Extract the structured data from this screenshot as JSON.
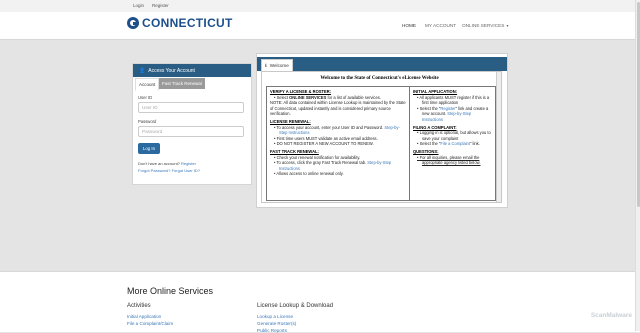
{
  "topbar": {
    "login": "Login",
    "register": "Register"
  },
  "header": {
    "logo_text": "CONNECTICUT",
    "nav": {
      "home": "HOME",
      "my_account": "MY ACCOUNT",
      "online_services": "ONLINE SERVICES"
    }
  },
  "login": {
    "heading": "Access Your Account",
    "tabs": {
      "account": "Account",
      "fast_track": "Fast Track Renewal"
    },
    "user_id_label": "User ID",
    "user_id_placeholder": "User ID",
    "password_label": "Password",
    "password_placeholder": "Password",
    "login_button": "Log In",
    "no_account_text": "Don't have an account?",
    "register_link": "Register",
    "forgot_password": "Forgot Password?",
    "forgot_user_id": "Forgot User ID?"
  },
  "welcome": {
    "tab_label": "Welcome",
    "title": "Welcome to the State of Connecticut's eLicense Website",
    "verify_heading": "VERIFY A LICENSE & ROSTER:",
    "verify_b1_pre": "Select ",
    "verify_b1_bold": "ONLINE SERVICES",
    "verify_b1_post": " for a list of available services.",
    "verify_note": "NOTE: All data contained within License Lookup is maintained by the State of Connecticut, updated instantly and is considered primary source verification.",
    "renewal_heading": "LICENSE RENEWAL:",
    "renewal_b1": "To access your account, enter your User ID and Password.",
    "renewal_b1_link": "Step-by-Step Instructions",
    "renewal_b2": "First time users MUST validate an active email address.",
    "renewal_b3": "DO NOT REGISTER A NEW ACCOUNT TO RENEW.",
    "fast_heading": "FAST TRACK RENEWAL:",
    "fast_b1": "Check your renewal notification for availability.",
    "fast_b2": "To access, click the gray Fast Track Renewal tab.",
    "fast_b2_link": "Step-by-Step Instructions",
    "fast_b3": "Allows access to online renewal only.",
    "initial_heading": "INITIAL APPLICATION:",
    "initial_b1": "All applicants MUST register if this is a first time application",
    "initial_b2_pre": "Select the \"",
    "initial_b2_link": "Register",
    "initial_b2_post": "\" link and create a new account.",
    "initial_b2_link2": "Step-by-Step Instructions",
    "complaint_heading": "FILING A COMPLAINT:",
    "complaint_b1": "Logging in is optional, but allows you to save your complaint",
    "complaint_b2_pre": "Select the \"",
    "complaint_b2_link": "File a Complaint",
    "complaint_b2_post": "\" link.",
    "questions_heading": "QUESTIONS:",
    "questions_b1": "For all inquiries, please email the appropriate agency listed below."
  },
  "footer": {
    "heading": "More Online Services",
    "activities_heading": "Activities",
    "activities": [
      "Initial Application",
      "File a Complaint/Claim"
    ],
    "lookup_heading": "License Lookup & Download",
    "lookup": [
      "Lookup a License",
      "Generate Roster(s)",
      "Public Reports"
    ]
  },
  "watermark": "ScanMalware",
  "colors": {
    "brand_blue": "#1d4f8c",
    "panel_header": "#2a5d83",
    "link": "#3b78b8",
    "button": "#2a6aa0"
  }
}
